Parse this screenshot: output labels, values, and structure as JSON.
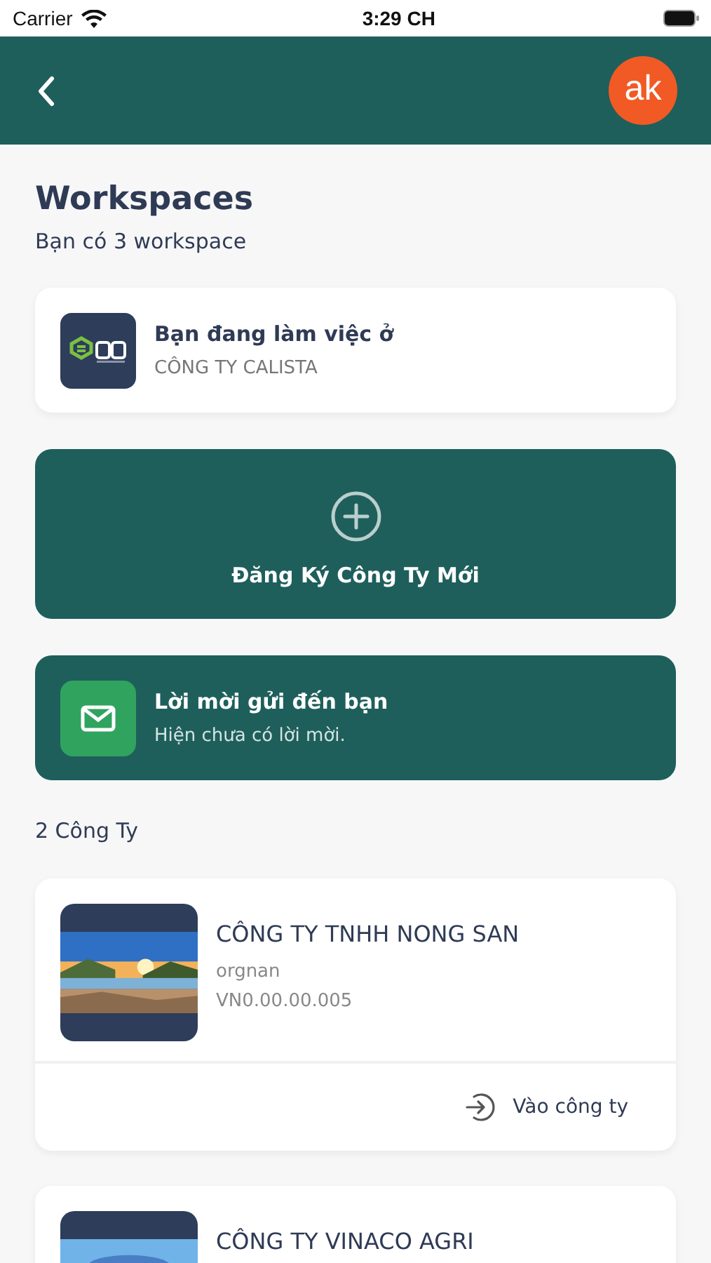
{
  "status_bar": {
    "carrier": "Carrier",
    "time": "3:29 CH"
  },
  "header": {
    "avatar": "ak"
  },
  "title": "Workspaces",
  "subtitle": "Bạn có 3 workspace",
  "current": {
    "label": "Bạn đang làm việc ở",
    "company": "CÔNG TY CALISTA"
  },
  "register": {
    "label": "Đăng Ký Công Ty Mới"
  },
  "invites": {
    "title": "Lời mời gửi đến bạn",
    "message": "Hiện chưa có lời mời."
  },
  "companies_heading": "2 Công Ty",
  "companies": [
    {
      "name": "CÔNG TY TNHH NONG SAN",
      "code": "orgnan",
      "tax_id": "VN0.00.00.005",
      "action": "Vào công ty"
    },
    {
      "name": "CÔNG TY VINACO AGRI"
    }
  ]
}
